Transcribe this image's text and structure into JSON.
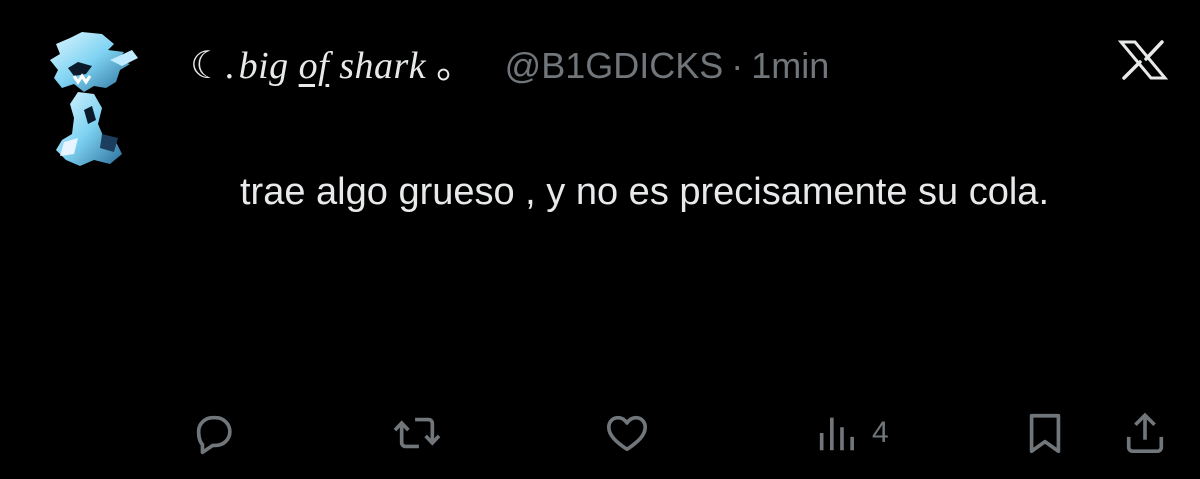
{
  "tweet": {
    "display_name_prefix": "☾.",
    "display_name_a": "big ",
    "display_name_b": "of",
    "display_name_c": " shark",
    "display_name_suffix": "。",
    "handle": "@B1GDICKS",
    "separator": "·",
    "time": "1min",
    "text": "trae algo grueso , y no es precisamente su cola."
  },
  "actions": {
    "reply_icon": "reply-icon",
    "retweet_icon": "retweet-icon",
    "like_icon": "heart-icon",
    "views_icon": "views-icon",
    "views_count": "4",
    "bookmark_icon": "bookmark-icon",
    "share_icon": "share-icon"
  },
  "colors": {
    "background": "#000000",
    "text": "#e7e9ea",
    "muted": "#71767b"
  }
}
